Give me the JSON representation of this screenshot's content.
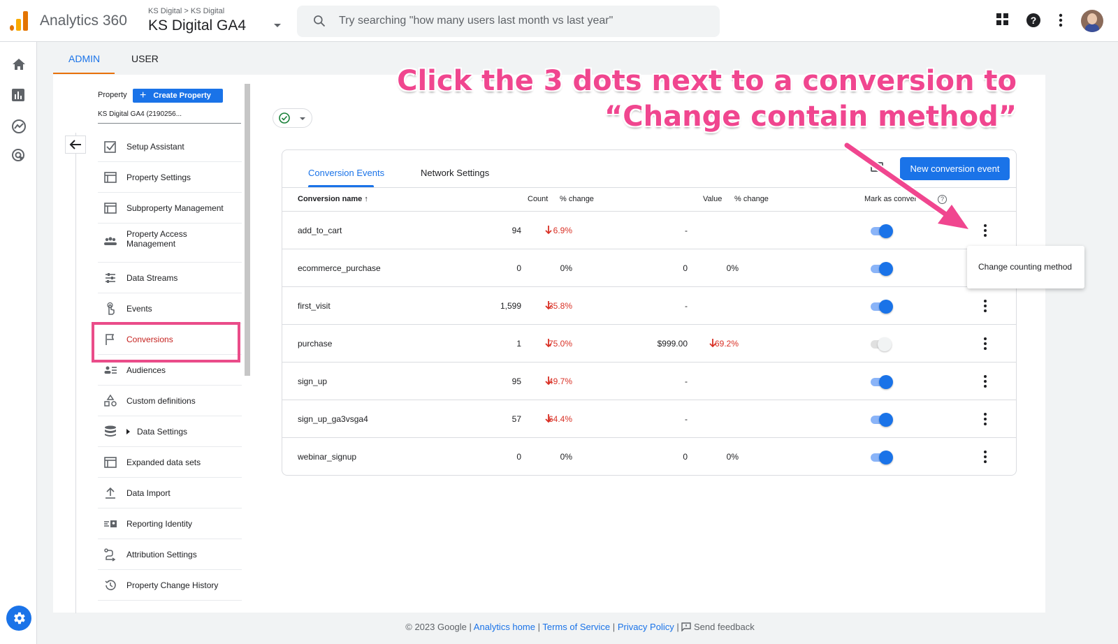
{
  "header": {
    "app_name": "Analytics 360",
    "breadcrumb_account": "KS Digital",
    "breadcrumb_sep": ">",
    "breadcrumb_property": "KS Digital",
    "property_name": "KS Digital GA4",
    "search_placeholder": "Try searching \"how many users last month vs last year\"",
    "icons": [
      "apps-grid-icon",
      "help-icon",
      "more-vert-icon",
      "avatar"
    ]
  },
  "rail": {
    "icons": [
      "home-icon",
      "reports-icon",
      "explore-icon",
      "advertising-icon",
      "admin-gear-icon"
    ]
  },
  "admin_tabs": {
    "admin": "ADMIN",
    "user": "USER"
  },
  "property_nav": {
    "property_label": "Property",
    "create_property_label": "Create Property",
    "selected_property": "KS Digital GA4 (2190256...",
    "items": [
      {
        "label": "Setup Assistant",
        "icon": "checkbox-icon"
      },
      {
        "label": "Property Settings",
        "icon": "panel-icon"
      },
      {
        "label": "Subproperty Management",
        "icon": "panel-icon"
      },
      {
        "label": "Property Access\nManagement",
        "icon": "people-icon"
      },
      {
        "label": "Data Streams",
        "icon": "streams-icon"
      },
      {
        "label": "Events",
        "icon": "touch-icon"
      },
      {
        "label": "Conversions",
        "icon": "flag-icon",
        "active": true
      },
      {
        "label": "Audiences",
        "icon": "audience-icon"
      },
      {
        "label": "Custom definitions",
        "icon": "shapes-icon"
      },
      {
        "label": "Data Settings",
        "icon": "database-icon"
      },
      {
        "label": "Expanded data sets",
        "icon": "panel-icon"
      },
      {
        "label": "Data Import",
        "icon": "upload-icon"
      },
      {
        "label": "Reporting Identity",
        "icon": "identity-icon"
      },
      {
        "label": "Attribution Settings",
        "icon": "attribution-icon"
      },
      {
        "label": "Property Change History",
        "icon": "history-icon"
      }
    ]
  },
  "conversions": {
    "tabs": [
      "Conversion Events",
      "Network Settings"
    ],
    "new_button": "New conversion event",
    "columns": {
      "name": "Conversion name",
      "count": "Count",
      "count_change": "% change",
      "value": "Value",
      "value_change": "% change",
      "mark": "Mark as conver",
      "help": "?"
    },
    "rows": [
      {
        "name": "add_to_cart",
        "count": "94",
        "count_change": "6.9%",
        "count_down": true,
        "value": "-",
        "value_change": "",
        "value_down": false,
        "enabled": true
      },
      {
        "name": "ecommerce_purchase",
        "count": "0",
        "count_change": "0%",
        "count_down": false,
        "value": "0",
        "value_change": "0%",
        "value_down": false,
        "enabled": true
      },
      {
        "name": "first_visit",
        "count": "1,599",
        "count_change": "35.8%",
        "count_down": true,
        "value": "-",
        "value_change": "",
        "value_down": false,
        "enabled": true
      },
      {
        "name": "purchase",
        "count": "1",
        "count_change": "75.0%",
        "count_down": true,
        "value": "$999.00",
        "value_change": "69.2%",
        "value_down": true,
        "enabled": false
      },
      {
        "name": "sign_up",
        "count": "95",
        "count_change": "49.7%",
        "count_down": true,
        "value": "-",
        "value_change": "",
        "value_down": false,
        "enabled": true
      },
      {
        "name": "sign_up_ga3vsga4",
        "count": "57",
        "count_change": "64.4%",
        "count_down": true,
        "value": "-",
        "value_change": "",
        "value_down": false,
        "enabled": true
      },
      {
        "name": "webinar_signup",
        "count": "0",
        "count_change": "0%",
        "count_down": false,
        "value": "0",
        "value_change": "0%",
        "value_down": false,
        "enabled": true
      }
    ],
    "menu_item": "Change counting method"
  },
  "annotation": {
    "line1": "Click the 3 dots next to a conversion to",
    "line2": "“Change contain method”",
    "color": "#f0468f"
  },
  "footer": {
    "copyright": "© 2023 Google |",
    "analytics_home": "Analytics home",
    "sep1": "|",
    "terms": "Terms of Service",
    "sep2": "|",
    "privacy": "Privacy Policy",
    "sep3": "|",
    "feedback": "Send feedback"
  },
  "colors": {
    "accent": "#1a73e8",
    "negative": "#d93025",
    "admin_tab_underline": "#e8710a",
    "highlight": "#ea4c89"
  }
}
